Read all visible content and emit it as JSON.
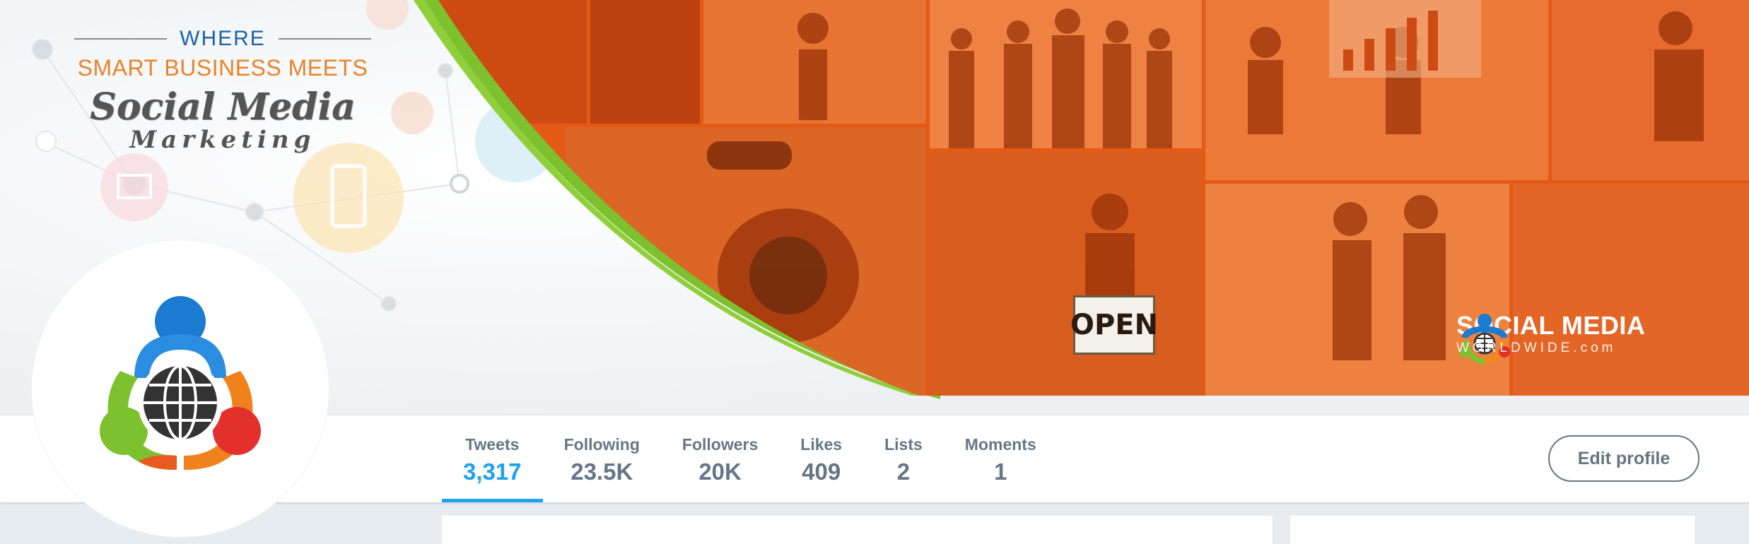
{
  "banner": {
    "tagline": {
      "where": "WHERE",
      "smart": "SMART BUSINESS MEETS",
      "social": "Social Media",
      "marketing": "Marketing"
    },
    "open_sign": "OPEN",
    "brand": {
      "name": "SOCIAL MEDIA",
      "sub": "WORLDWIDE.com"
    },
    "colors": {
      "arc": "#7ec12f",
      "photo_tint": "#e55a14",
      "tagline_blue": "#1a63a8",
      "tagline_orange": "#e8832a"
    }
  },
  "stats": [
    {
      "label": "Tweets",
      "value": "3,317",
      "active": true
    },
    {
      "label": "Following",
      "value": "23.5K"
    },
    {
      "label": "Followers",
      "value": "20K"
    },
    {
      "label": "Likes",
      "value": "409"
    },
    {
      "label": "Lists",
      "value": "2"
    },
    {
      "label": "Moments",
      "value": "1"
    }
  ],
  "actions": {
    "edit_profile": "Edit profile"
  },
  "colors": {
    "accent": "#1da1f2",
    "muted": "#657786",
    "background": "#e6ecf0"
  }
}
